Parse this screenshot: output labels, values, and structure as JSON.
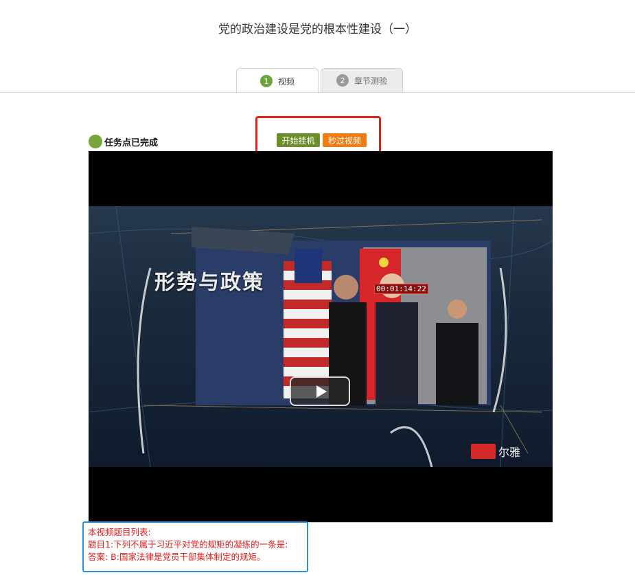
{
  "page": {
    "title": "党的政治建设是党的根本性建设（一）"
  },
  "tabs": [
    {
      "number": "1",
      "label": "视频"
    },
    {
      "number": "2",
      "label": "章节测验"
    }
  ],
  "task": {
    "status_label": "任务点已完成"
  },
  "toolbar": {
    "start_hang_label": "开始挂机",
    "skip_video_label": "秒过视频"
  },
  "video": {
    "overlay_title": "形势与政策",
    "timestamp": "00:01:14:22",
    "logo_text": "尔雅"
  },
  "qa": {
    "header": "本视频题目列表:",
    "question": "题目1:下列不属于习近平对党的规矩的凝练的一条是:",
    "answer": "答案:   B:国家法律是党员干部集体制定的规矩。"
  },
  "colors": {
    "accent_green": "#6b8f2c",
    "accent_orange": "#ef7d12",
    "highlight_red": "#e8201d",
    "highlight_blue": "#2c8fe0",
    "answer_text": "#e11c1c"
  }
}
